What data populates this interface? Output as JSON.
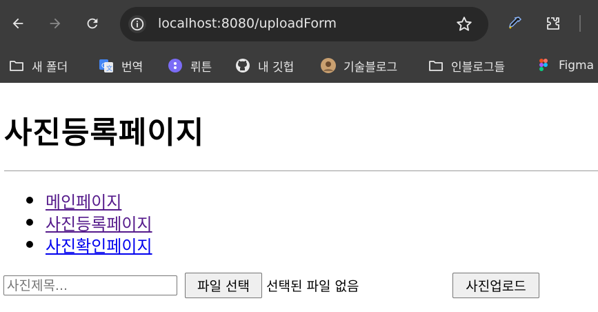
{
  "browser": {
    "url": "localhost:8080/uploadForm",
    "bookmarks": [
      {
        "label": "새 폴더",
        "icon": "folder-icon"
      },
      {
        "label": "번역",
        "icon": "google-translate-icon"
      },
      {
        "label": "뤼튼",
        "icon": "wrtn-icon"
      },
      {
        "label": "내 깃헙",
        "icon": "github-icon"
      },
      {
        "label": "기술블로그",
        "icon": "avatar-icon"
      },
      {
        "label": "인블로그들",
        "icon": "folder-icon"
      },
      {
        "label": "Figma",
        "icon": "figma-icon"
      }
    ]
  },
  "page": {
    "heading": "사진등록페이지",
    "nav_links": [
      {
        "label": "메인페이지",
        "visited": true
      },
      {
        "label": "사진등록페이지",
        "visited": true
      },
      {
        "label": "사진확인페이지",
        "visited": false
      }
    ],
    "form": {
      "title_placeholder": "사진제목...",
      "title_value": "",
      "file_button_label": "파일 선택",
      "file_status": "선택된 파일 없음",
      "submit_label": "사진업로드"
    }
  },
  "colors": {
    "toolbar_bg": "#3c3c3c",
    "omnibox_bg": "#282828",
    "visited_link": "#551a8b",
    "unvisited_link": "#0000ee"
  }
}
